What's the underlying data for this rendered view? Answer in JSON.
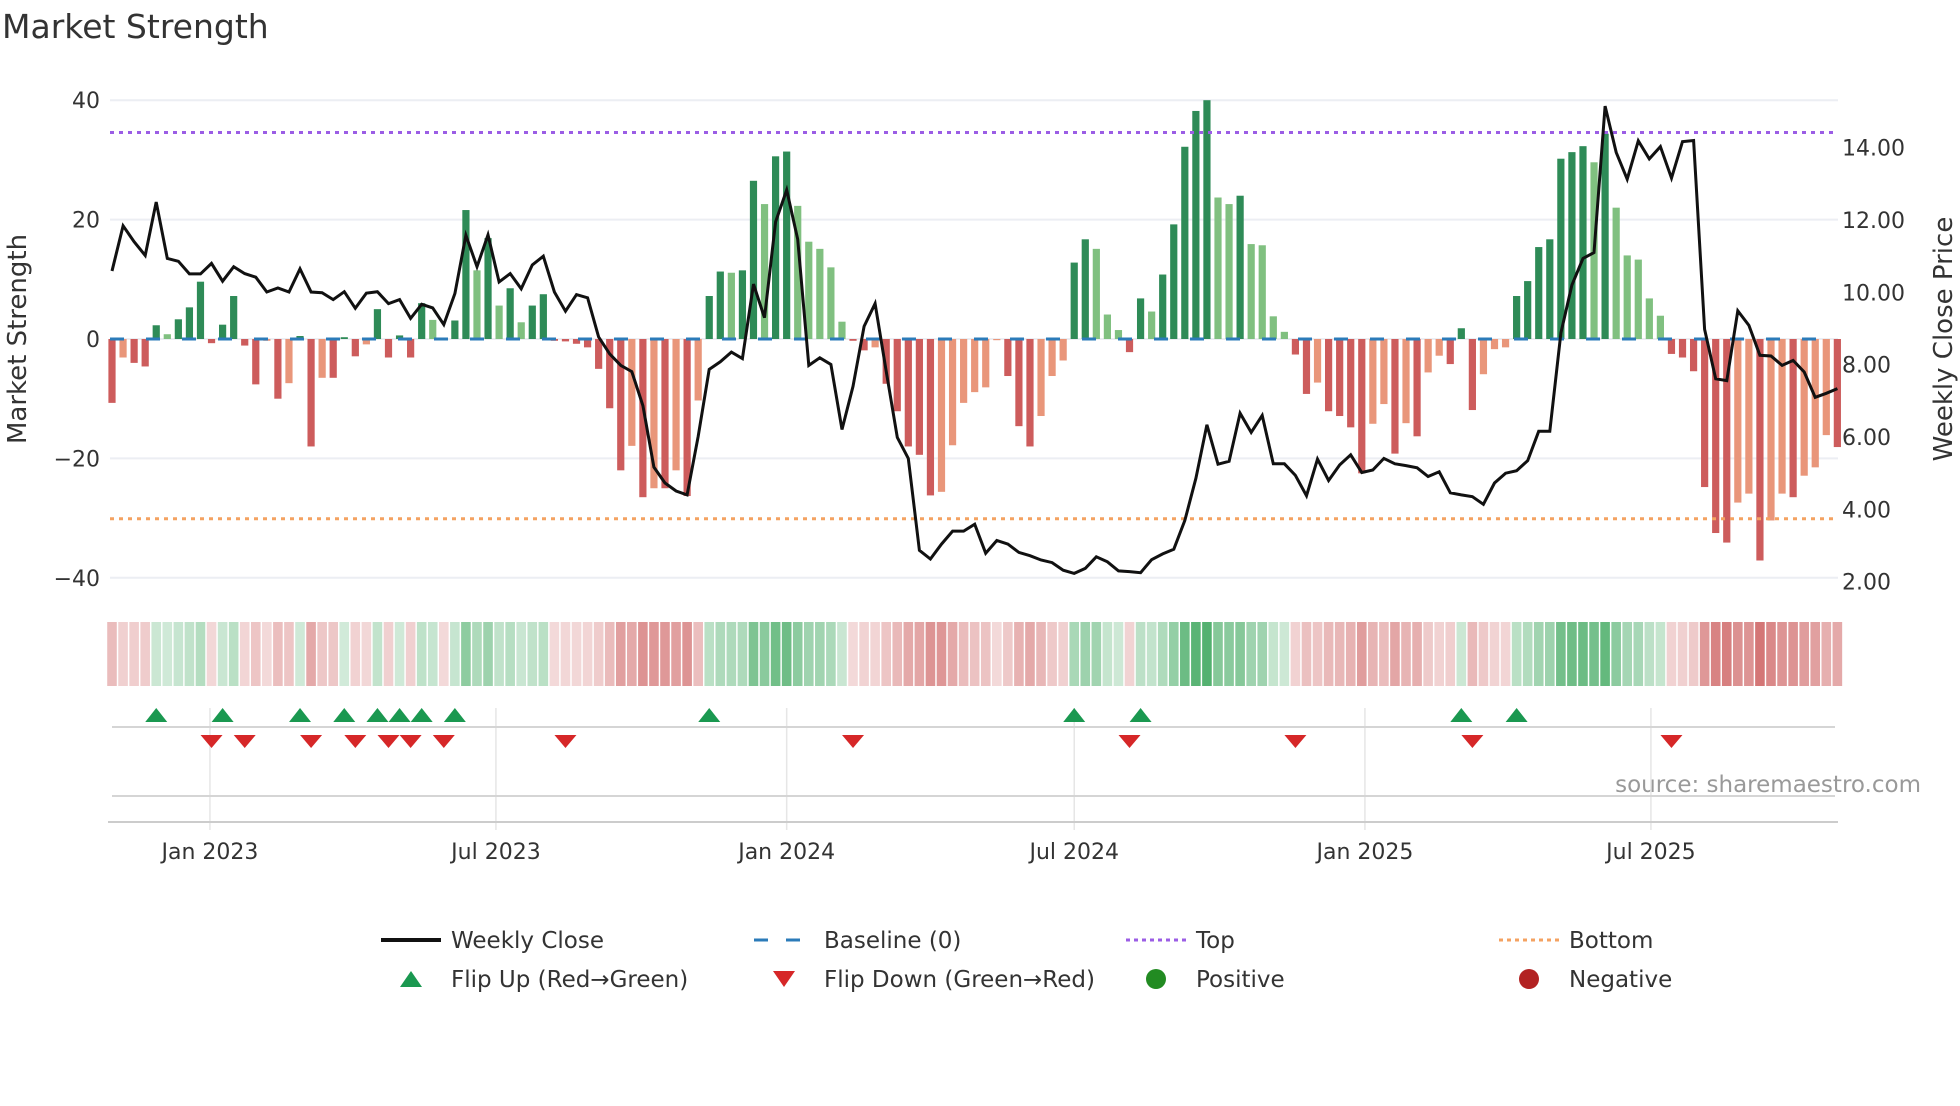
{
  "chart_data": {
    "type": "bar+line",
    "title": "Market Strength",
    "ylabel": "Market Strength",
    "y2label": "Weekly Close Price",
    "source": "source: sharemaestro.com",
    "first_week": "2022-10-31",
    "frequency": "weekly",
    "ylim": [
      -43.7,
      42.6
    ],
    "y2lim": [
      1.49,
      15.73
    ],
    "yticks": [
      {
        "v": 40,
        "label": "40"
      },
      {
        "v": 20,
        "label": "20"
      },
      {
        "v": 0,
        "label": "0"
      },
      {
        "v": -20,
        "label": "−20"
      },
      {
        "v": -40,
        "label": "−40"
      }
    ],
    "y2ticks": [
      {
        "v": 14,
        "label": "14.00"
      },
      {
        "v": 12,
        "label": "12.00"
      },
      {
        "v": 10,
        "label": "10.00"
      },
      {
        "v": 8,
        "label": "8.00"
      },
      {
        "v": 6,
        "label": "6.00"
      },
      {
        "v": 4,
        "label": "4.00"
      },
      {
        "v": 2,
        "label": "2.00"
      }
    ],
    "xticks": [
      {
        "date": "2023-01-01",
        "label": "Jan 2023"
      },
      {
        "date": "2023-07-01",
        "label": "Jul 2023"
      },
      {
        "date": "2024-01-01",
        "label": "Jan 2024"
      },
      {
        "date": "2024-07-01",
        "label": "Jul 2024"
      },
      {
        "date": "2025-01-01",
        "label": "Jan 2025"
      },
      {
        "date": "2025-07-01",
        "label": "Jul 2025"
      }
    ],
    "top_level": 34.6,
    "bottom_level": -30.1,
    "baseline": 0,
    "strength": [
      -10.7,
      -3.1,
      -4,
      -4.6,
      2.3,
      0.8,
      3.3,
      5.3,
      9.6,
      -0.7,
      2.4,
      7.2,
      -1.1,
      -7.6,
      -0.3,
      -10,
      -7.4,
      0.5,
      -18,
      -6.5,
      -6.5,
      0.3,
      -2.9,
      -0.9,
      5,
      -3.1,
      0.6,
      -3.1,
      6,
      3.2,
      -0.2,
      3.1,
      21.6,
      11.5,
      16.9,
      5.6,
      8.5,
      2.8,
      5.6,
      7.5,
      -0.3,
      -0.4,
      -0.8,
      -1.4,
      -5,
      -11.6,
      -22,
      -17.9,
      -26.5,
      -25,
      -25,
      -22,
      -26.3,
      -10.3,
      7.2,
      11.3,
      11.1,
      11.5,
      26.5,
      22.6,
      30.6,
      31.4,
      22.3,
      16.3,
      15.1,
      12,
      2.9,
      -0.3,
      -1.9,
      -1.4,
      -7.5,
      -12.1,
      -18,
      -19.4,
      -26.2,
      -25.6,
      -17.8,
      -10.7,
      -8.9,
      -8.1,
      -0.2,
      -6.2,
      -14.6,
      -18,
      -12.9,
      -6.2,
      -3.6,
      12.8,
      16.7,
      15.1,
      4.1,
      1.5,
      -2.2,
      6.8,
      4.6,
      10.8,
      19.2,
      32.2,
      38.2,
      40,
      23.7,
      22.6,
      24,
      15.9,
      15.7,
      3.8,
      1.2,
      -2.6,
      -9.2,
      -7.3,
      -12.1,
      -12.9,
      -14.8,
      -22.5,
      -14.2,
      -10.9,
      -19.2,
      -14.1,
      -16.3,
      -5.6,
      -2.8,
      -4.2,
      1.8,
      -11.9,
      -5.9,
      -1.7,
      -1.4,
      7.2,
      9.7,
      15.4,
      16.7,
      30.2,
      31.3,
      32.3,
      29.6,
      34.4,
      22,
      14,
      13.3,
      6.8,
      3.9,
      -2.5,
      -3.1,
      -5.4,
      -24.8,
      -32.5,
      -34.1,
      -27.4,
      -25.9,
      -37.1,
      -30.4,
      -25.9,
      -26.5,
      -22.9,
      -21.5,
      -16.1,
      -18.1
    ],
    "close": [
      10.59,
      11.84,
      11.4,
      11.02,
      12.5,
      10.94,
      10.86,
      10.51,
      10.51,
      10.8,
      10.31,
      10.71,
      10.52,
      10.42,
      10.01,
      10.12,
      10.01,
      10.65,
      10.01,
      9.99,
      9.8,
      10.02,
      9.56,
      9.98,
      10.02,
      9.69,
      9.8,
      9.28,
      9.67,
      9.57,
      9.11,
      9.97,
      11.58,
      10.71,
      11.59,
      10.29,
      10.52,
      10.1,
      10.76,
      11.0,
      10.01,
      9.48,
      9.94,
      9.85,
      8.77,
      8.3,
      7.98,
      7.81,
      6.87,
      5.17,
      4.73,
      4.51,
      4.4,
      6.02,
      7.87,
      8.08,
      8.35,
      8.17,
      10.23,
      9.3,
      11.95,
      12.83,
      11.47,
      7.98,
      8.19,
      8.01,
      6.21,
      7.4,
      9.06,
      9.69,
      7.82,
      5.99,
      5.41,
      2.87,
      2.63,
      3.04,
      3.4,
      3.4,
      3.59,
      2.79,
      3.14,
      3.04,
      2.81,
      2.72,
      2.6,
      2.53,
      2.32,
      2.23,
      2.37,
      2.69,
      2.55,
      2.3,
      2.28,
      2.25,
      2.61,
      2.77,
      2.9,
      3.69,
      4.86,
      6.34,
      5.25,
      5.33,
      6.66,
      6.13,
      6.6,
      5.26,
      5.26,
      4.94,
      4.38,
      5.39,
      4.8,
      5.23,
      5.51,
      5.02,
      5.09,
      5.41,
      5.26,
      5.21,
      5.15,
      4.91,
      5.04,
      4.46,
      4.4,
      4.35,
      4.14,
      4.73,
      5.0,
      5.07,
      5.35,
      6.16,
      6.16,
      8.88,
      10.2,
      10.94,
      11.1,
      15.15,
      13.87,
      13.13,
      14.19,
      13.69,
      14.03,
      13.16,
      14.17,
      14.2,
      8.98,
      7.61,
      7.56,
      9.49,
      9.09,
      8.26,
      8.24,
      7.98,
      8.12,
      7.8,
      7.1,
      7.21,
      7.34
    ],
    "flip_up_weeks": [
      4,
      10,
      17,
      21,
      24,
      26,
      28,
      31,
      54,
      87,
      93,
      122,
      127
    ],
    "flip_down_weeks": [
      9,
      12,
      18,
      22,
      25,
      27,
      30,
      41,
      67,
      92,
      107,
      123,
      141
    ],
    "legend": {
      "placement": "bottom",
      "items": [
        {
          "label": "Weekly Close",
          "kind": "line"
        },
        {
          "label": "Baseline (0)",
          "kind": "dash"
        },
        {
          "label": "Top",
          "kind": "dot-top"
        },
        {
          "label": "Bottom",
          "kind": "dot-bottom"
        },
        {
          "label": "Flip Up (Red→Green)",
          "kind": "tri-up"
        },
        {
          "label": "Flip Down (Green→Red)",
          "kind": "tri-down"
        },
        {
          "label": "Positive",
          "kind": "dot-pos"
        },
        {
          "label": "Negative",
          "kind": "dot-neg"
        }
      ]
    },
    "colors": {
      "pos_strong": "#2e8b57",
      "pos_weak": "#80c080",
      "neg_strong": "#cd5c5c",
      "neg_weak": "#e9967a",
      "close": "#111111",
      "baseline": "#2b7bb9",
      "top": "#9b5de5",
      "bottom": "#f4a261",
      "flip_up": "#1a9850",
      "flip_down": "#d62728",
      "positive": "#228b22",
      "negative": "#b22222"
    }
  }
}
